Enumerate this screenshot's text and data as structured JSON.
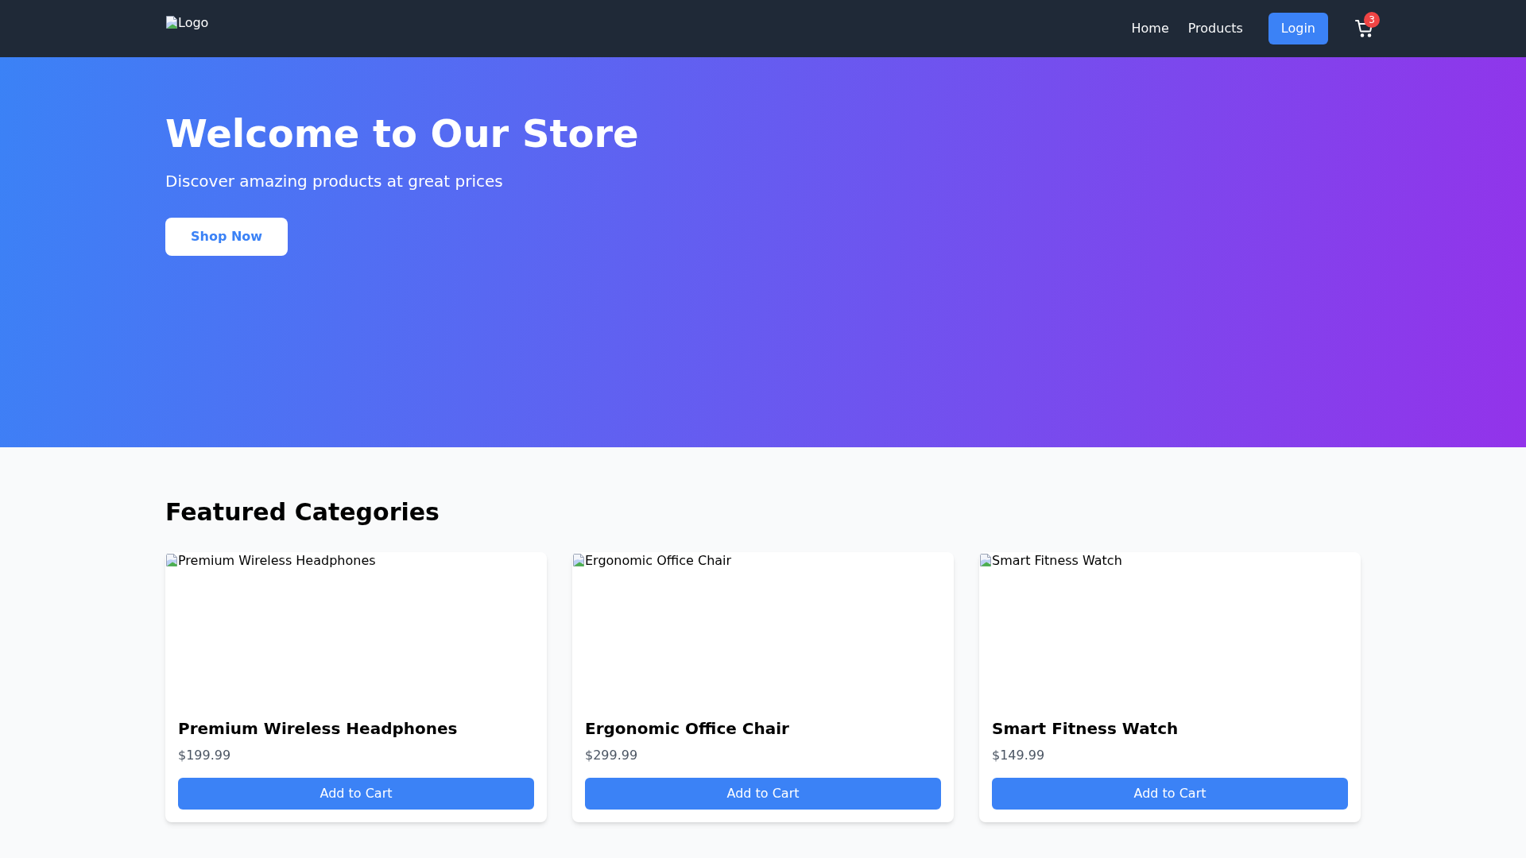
{
  "header": {
    "logo": {
      "alt": "Logo"
    },
    "nav": [
      {
        "label": "Home",
        "kind": "link"
      },
      {
        "label": "Products",
        "kind": "link"
      },
      {
        "label": "Login",
        "kind": "button"
      }
    ],
    "cart": {
      "badge": "3"
    }
  },
  "hero": {
    "title": "Welcome to Our Store",
    "subtitle": "Discover amazing products at great prices",
    "button": "Shop Now"
  },
  "featured": {
    "title": "Featured Categories",
    "products": [
      {
        "image_alt": "Premium Wireless Headphones",
        "name": "Premium Wireless Headphones",
        "price": "$199.99",
        "button": "Add to Cart"
      },
      {
        "image_alt": "Ergonomic Office Chair",
        "name": "Ergonomic Office Chair",
        "price": "$299.99",
        "button": "Add to Cart"
      },
      {
        "image_alt": "Smart Fitness Watch",
        "name": "Smart Fitness Watch",
        "price": "$149.99",
        "button": "Add to Cart"
      }
    ]
  }
}
